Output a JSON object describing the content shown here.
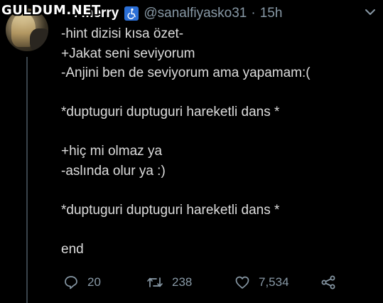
{
  "watermark": {
    "text": "GULDUM.NET"
  },
  "tweet": {
    "display_name_visible": "i merry",
    "handle": "@sanalfiyasko31",
    "separator": "·",
    "time": "15h",
    "body_lines": [
      "-hint dizisi kısa özet-",
      "+Jakat seni seviyorum",
      "-Anjini ben de seviyorum ama yapamam:(",
      "",
      "*duptuguri duptuguri hareketli dans *",
      "",
      "+hiç mi olmaz ya",
      "-aslında olur ya :)",
      "",
      "*duptuguri duptuguri hareketli dans *",
      "",
      "end"
    ],
    "actions": {
      "reply_count": "20",
      "retweet_count": "238",
      "like_count": "7,534"
    }
  },
  "icons": {
    "name_badge": "wheelchair-accessible-icon",
    "menu": "chevron-down-icon",
    "reply": "reply-bubble-icon",
    "retweet": "retweet-icon",
    "like": "heart-icon",
    "share": "share-icon"
  },
  "colors": {
    "background": "#000000",
    "text": "#dcdcdc",
    "muted": "#8899a6",
    "badge": "#2b6fd6"
  }
}
